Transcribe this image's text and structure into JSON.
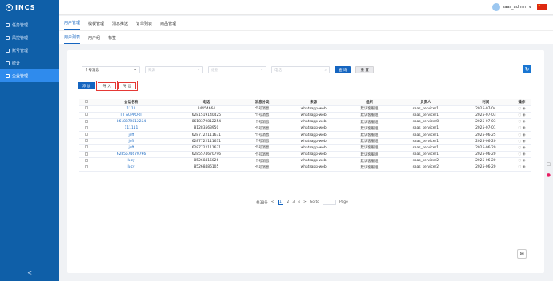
{
  "app": {
    "logo": "INCS"
  },
  "sidebar": {
    "items": [
      {
        "label": "任务管理",
        "icon": "task-icon"
      },
      {
        "label": "风控管理",
        "icon": "shield-icon"
      },
      {
        "label": "账号管理",
        "icon": "user-icon"
      },
      {
        "label": "统计",
        "icon": "chart-icon"
      },
      {
        "label": "企业管理",
        "icon": "building-icon"
      }
    ],
    "collapse": "<"
  },
  "topbar": {
    "user": "saas_admin",
    "chev": "∨"
  },
  "tabs1": [
    "用户管理",
    "模板管理",
    "消息推送",
    "订单列表",
    "商品管理"
  ],
  "tabs2": [
    "用户列表",
    "用户组",
    "标签"
  ],
  "filters": {
    "type_value": "个号消息",
    "source_ph": "来源",
    "group_ph": "组别",
    "search_ph": "电话",
    "query": "查 询",
    "reset": "重 置"
  },
  "actions": {
    "add": "添 加",
    "import": "导 入",
    "export": "导 出"
  },
  "table": {
    "headers": [
      "会话名称",
      "电话",
      "消息分类",
      "来源",
      "组织",
      "负责人",
      "时间",
      "操作"
    ],
    "rows": [
      [
        "1111",
        "24454664",
        "个号消息",
        "whatsapp-web",
        "默认客服组",
        "saas_servicer1",
        "2025-07-04"
      ],
      [
        "IIT SUPPORT",
        "6281519140425",
        "个号消息",
        "whatsapp-web",
        "默认客服组",
        "saas_servicer1",
        "2025-07-03"
      ],
      [
        "8618379812254",
        "8618379812254",
        "个号消息",
        "whatsapp-web",
        "默认客服组",
        "saas_servicer8",
        "2025-07-03"
      ],
      [
        "111111",
        "81283563950",
        "个号消息",
        "whatsapp-web",
        "默认客服组",
        "saas_servicer1",
        "2025-07-01"
      ],
      [
        "jeff",
        "6287722111631",
        "个号消息",
        "whatsapp-web",
        "默认客服组",
        "saas_servicer1",
        "2025-06-25"
      ],
      [
        "jeff",
        "6287722111631",
        "个号消息",
        "whatsapp-web",
        "默认客服组",
        "saas_servicer1",
        "2025-06-20"
      ],
      [
        "jeff",
        "6287722111631",
        "个号消息",
        "whatsapp-web",
        "默认客服组",
        "saas_servicer1",
        "2025-06-20"
      ],
      [
        "6285574670796",
        "6285574670796",
        "个号消息",
        "whatsapp-web",
        "默认客服组",
        "saas_servicer1",
        "2025-06-20"
      ],
      [
        "lucy",
        "85268415026",
        "个号消息",
        "whatsapp-web",
        "默认客服组",
        "saas_servicer2",
        "2025-06-20"
      ],
      [
        "lucy",
        "85268486105",
        "个号消息",
        "whatsapp-web",
        "默认客服组",
        "saas_servicer2",
        "2025-06-20"
      ]
    ]
  },
  "pager": {
    "total": "共38条",
    "prev": "<",
    "pages": [
      "1",
      "2",
      "3",
      "4"
    ],
    "next": ">",
    "goto": "Go to",
    "page": "Page"
  },
  "colors": {
    "sidebar": "#0f5fa8",
    "primary": "#1565c0",
    "danger": "#e53935"
  }
}
